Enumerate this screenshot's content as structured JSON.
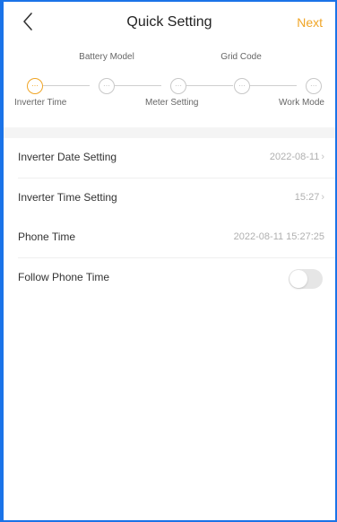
{
  "header": {
    "title": "Quick Setting",
    "next_label": "Next",
    "back_icon": "chevron-left-icon"
  },
  "steps": {
    "top_labels": [
      "Battery Model",
      "Grid Code"
    ],
    "bottom_labels": [
      "Inverter Time",
      "Meter Setting",
      "Work Mode"
    ],
    "active_index": 0,
    "count": 5
  },
  "settings": {
    "inverter_date": {
      "label": "Inverter Date Setting",
      "value": "2022-08-11"
    },
    "inverter_time": {
      "label": "Inverter Time Setting",
      "value": "15:27"
    },
    "phone_time": {
      "label": "Phone Time",
      "value": "2022-08-11 15:27:25"
    },
    "follow_phone_time": {
      "label": "Follow Phone Time",
      "enabled": false
    }
  },
  "colors": {
    "accent": "#f0a526",
    "frame": "#1a73e8"
  }
}
